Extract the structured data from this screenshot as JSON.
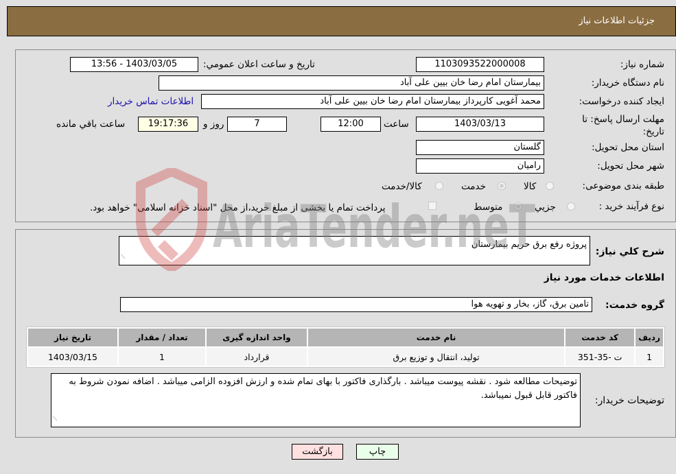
{
  "header": {
    "title": "جزئیات اطلاعات نیاز"
  },
  "details": {
    "need_number_label": "شماره نیاز:",
    "need_number": "1103093522000008",
    "announce_label": "تاریخ و ساعت اعلان عمومي:",
    "announce_value": "1403/03/05 - 13:56",
    "buyer_org_label": "نام دستگاه خریدار:",
    "buyer_org": "بیمارستان امام رضا خان بیین علی آباد",
    "creator_label": "ایجاد کننده درخواست:",
    "creator": "محمد  آغویی کارپرداز بیمارستان امام رضا خان بیین علی آباد",
    "contact_link": "اطلاعات تماس خریدار",
    "deadline_label": "مهلت ارسال پاسخ: تا تاریخ:",
    "deadline_date": "1403/03/13",
    "time_label": "ساعت",
    "deadline_time": "12:00",
    "days_value": "7",
    "days_label": "روز و",
    "remaining_time": "19:17:36",
    "remaining_label": "ساعت باقي مانده",
    "province_label": "استان محل تحویل:",
    "province": "گلستان",
    "city_label": "شهر محل تحویل:",
    "city": "رامیان",
    "category_label": "طبقه بندی موضوعی:",
    "category_options": [
      {
        "label": "کالا",
        "selected": false
      },
      {
        "label": "خدمت",
        "selected": true
      },
      {
        "label": "کالا/خدمت",
        "selected": false
      }
    ],
    "purchase_type_label": "نوع فرآیند خرید :",
    "purchase_type_options": [
      {
        "label": "جزیي",
        "selected": false
      },
      {
        "label": "متوسط",
        "selected": true
      }
    ],
    "treasury_checkbox_checked": false,
    "treasury_text": "پرداخت تمام یا بخشی از مبلغ خرید،از محل \"اسناد خزانه اسلامی\" خواهد بود."
  },
  "summary": {
    "description_label": "شرح کلي نیاز:",
    "description": "پروژه رفع برق حریم بیمارستان",
    "services_heading": "اطلاعات خدمات مورد نیاز",
    "service_group_label": "گروه خدمت:",
    "service_group": "تامین برق، گاز، بخار و تهویه هوا",
    "table": {
      "headers": [
        "ردیف",
        "کد خدمت",
        "نام خدمت",
        "واحد اندازه گیری",
        "تعداد / مقدار",
        "تاریخ نیاز"
      ],
      "rows": [
        [
          "1",
          "ت -35-351",
          "تولید، انتقال و توزیع برق",
          "قرارداد",
          "1",
          "1403/03/15"
        ]
      ]
    },
    "buyer_notes_label": "توضیحات خریدار:",
    "buyer_notes": "توضیحات مطالعه شود . نقشه پیوست میباشد . بارگذاری فاکتور با بهای تمام شده و ارزش افزوده الزامی میباشد . اضافه نمودن شروط به فاکتور قابل قبول نمیباشد."
  },
  "buttons": {
    "print": "چاپ",
    "back": "بازگشت"
  },
  "watermark": {
    "text": "AriaTender.neT"
  },
  "colors": {
    "header_bg": "#8b6d42",
    "print_bg": "#eaffea",
    "back_bg": "#ffe0e0",
    "link": "#1a0dab"
  }
}
